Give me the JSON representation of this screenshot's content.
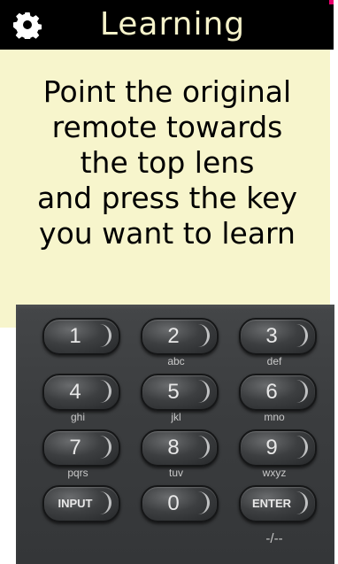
{
  "header": {
    "title": "Learning",
    "icon": "gear-icon",
    "background": "#000000",
    "title_color": "#f5f2c9"
  },
  "instructions": {
    "lines": [
      "Point the original",
      "remote towards",
      "the top lens",
      "and press the key",
      "you want to learn"
    ]
  },
  "remote": {
    "keys": [
      {
        "label": "1",
        "sub": ""
      },
      {
        "label": "2",
        "sub": "abc"
      },
      {
        "label": "3",
        "sub": "def"
      },
      {
        "label": "4",
        "sub": "ghi"
      },
      {
        "label": "5",
        "sub": "jkl"
      },
      {
        "label": "6",
        "sub": "mno"
      },
      {
        "label": "7",
        "sub": "pqrs"
      },
      {
        "label": "8",
        "sub": "tuv"
      },
      {
        "label": "9",
        "sub": "wxyz"
      },
      {
        "label": "INPUT",
        "sub": ""
      },
      {
        "label": "0",
        "sub": ""
      },
      {
        "label": "ENTER",
        "sub": "-/--"
      }
    ]
  },
  "colors": {
    "panel_background": "#f7f5cc",
    "accent": "#e8006d"
  }
}
